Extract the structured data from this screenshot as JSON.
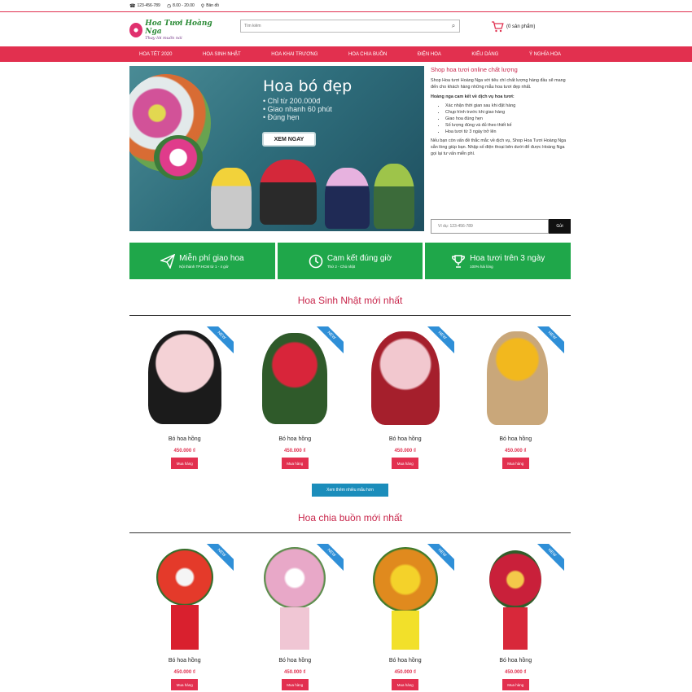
{
  "topbar": {
    "phone": "123-456-789",
    "hours": "8.00 - 20.00",
    "map": "Bản đồ"
  },
  "logo": {
    "main": "Hoa Tươi Hoàng Nga",
    "tagline": "Thay lời muốn nói"
  },
  "search": {
    "placeholder": "Tìm kiếm"
  },
  "cart": {
    "label": "(0 sản phẩm)"
  },
  "nav": [
    "HOA TẾT 2020",
    "HOA SINH NHẬT",
    "HOA KHAI TRƯƠNG",
    "HOA CHIA BUỒN",
    "ĐIỆN HOA",
    "KIỂU DÁNG",
    "Ý NGHĨA HOA"
  ],
  "banner": {
    "title": "Hoa bó đẹp",
    "lines": [
      "Chỉ từ 200.000đ",
      "Giao nhanh 60 phút",
      "Đúng hẹn"
    ],
    "button": "XEM NGAY"
  },
  "intro": {
    "title": "Shop hoa tươi online chất lượng",
    "p1": "Shop Hoa tươi Hoàng Nga với tiêu chí chất lượng hàng đầu sẽ mang đến cho khách hàng những mẫu hoa tươi đẹp nhất.",
    "commit_title": "Hoàng nga cam kết về dịch vụ hoa tươi:",
    "commits": [
      "Xác nhận thời gian sau khi đặt hàng",
      "Chụp hình trước khi giao hàng",
      "Giao hoa đúng hẹn",
      "Số lượng đúng và đủ theo thiết kế",
      "Hoa tươi từ 3 ngày trở lên"
    ],
    "p2": "Nếu bạn còn vấn đề thắc mắc về dịch vụ, Shop Hoa Tươi Hoàng Nga sẵn lòng giúp bạn. Nhập số điện thoại bên dưới để được Hoàng Nga gọi lại tư vấn miễn phí.",
    "phone_placeholder": "Ví dụ: 123-456-789",
    "send": "Gửi"
  },
  "features": [
    {
      "icon": "paper-plane-icon",
      "main": "Miễn phí giao hoa",
      "sub": "Nội thành TP.HCM từ 1 - 4 giờ"
    },
    {
      "icon": "clock-icon",
      "main": "Cam kết đúng giờ",
      "sub": "Thứ 2 - Chủ nhật"
    },
    {
      "icon": "trophy-icon",
      "main": "Hoa tươi trên 3 ngày",
      "sub": "100% hài lòng"
    }
  ],
  "section1": {
    "title": "Hoa Sinh Nhật mới nhất",
    "products": [
      {
        "name": "Bó hoa hồng",
        "price": "450.000 ₫",
        "button": "Mua hàng",
        "badge": "NEW"
      },
      {
        "name": "Bó hoa hồng",
        "price": "450.000 ₫",
        "button": "Mua hàng",
        "badge": "NEW"
      },
      {
        "name": "Bó hoa hồng",
        "price": "450.000 ₫",
        "button": "Mua hàng",
        "badge": "NEW"
      },
      {
        "name": "Bó hoa hồng",
        "price": "450.000 ₫",
        "button": "Mua hàng",
        "badge": "NEW"
      }
    ],
    "more": "Xem thêm nhiều mẫu hơn"
  },
  "section2": {
    "title": "Hoa chia buồn mới nhất",
    "products": [
      {
        "name": "Bó hoa hồng",
        "price": "450.000 ₫",
        "button": "Mua hàng",
        "badge": "NEW"
      },
      {
        "name": "Bó hoa hồng",
        "price": "450.000 ₫",
        "button": "Mua hàng",
        "badge": "NEW"
      },
      {
        "name": "Bó hoa hồng",
        "price": "450.000 ₫",
        "button": "Mua hàng",
        "badge": "NEW"
      },
      {
        "name": "Bó hoa hồng",
        "price": "450.000 ₫",
        "button": "Mua hàng",
        "badge": "NEW"
      }
    ]
  },
  "colors": {
    "brand": "#e2304f",
    "green": "#1fa74a",
    "blue": "#1b8dbb",
    "title": "#c8254a"
  }
}
